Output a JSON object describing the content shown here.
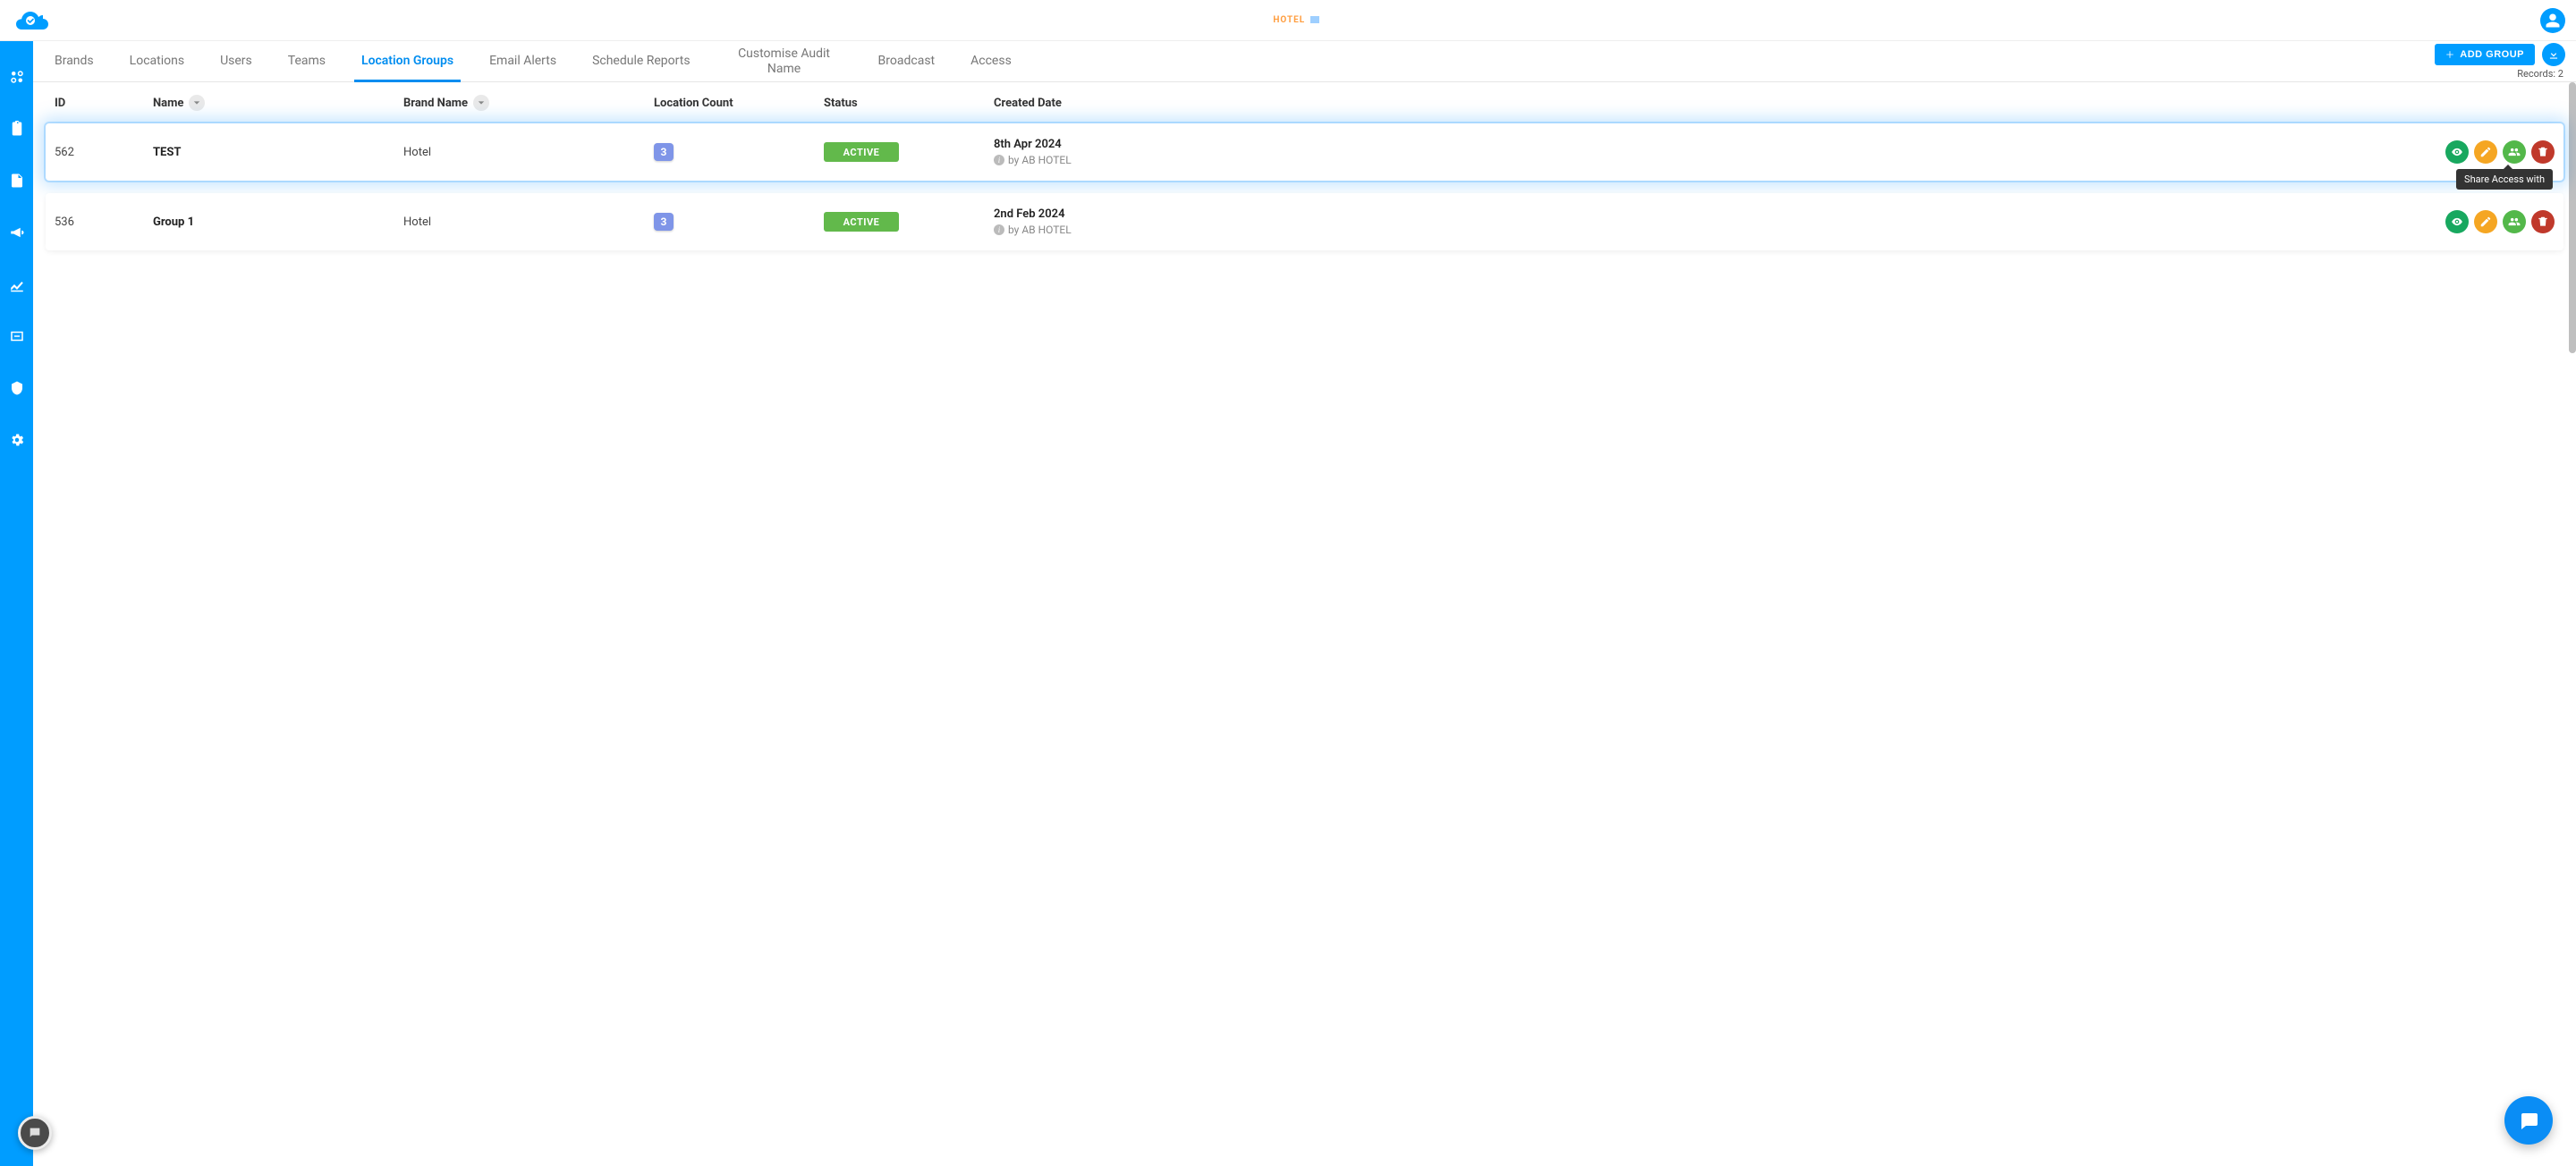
{
  "header": {
    "center_label": "HOTEL"
  },
  "tabs": [
    {
      "label": "Brands",
      "active": false
    },
    {
      "label": "Locations",
      "active": false
    },
    {
      "label": "Users",
      "active": false
    },
    {
      "label": "Teams",
      "active": false
    },
    {
      "label": "Location Groups",
      "active": true
    },
    {
      "label": "Email Alerts",
      "active": false
    },
    {
      "label": "Schedule Reports",
      "active": false
    },
    {
      "label": "Customise Audit Name",
      "active": false
    },
    {
      "label": "Broadcast",
      "active": false
    },
    {
      "label": "Access",
      "active": false
    }
  ],
  "actions": {
    "add_group_label": "ADD GROUP",
    "records_label": "Records: 2"
  },
  "columns": {
    "id": "ID",
    "name": "Name",
    "brand": "Brand Name",
    "location_count": "Location Count",
    "status": "Status",
    "created_date": "Created Date"
  },
  "rows": [
    {
      "id": "562",
      "name": "TEST",
      "brand": "Hotel",
      "location_count": "3",
      "status": "ACTIVE",
      "date": "8th Apr 2024",
      "by": "by AB HOTEL",
      "highlighted": true,
      "show_tooltip": true
    },
    {
      "id": "536",
      "name": "Group 1",
      "brand": "Hotel",
      "location_count": "3",
      "status": "ACTIVE",
      "date": "2nd Feb 2024",
      "by": "by AB HOTEL",
      "highlighted": false,
      "show_tooltip": false
    }
  ],
  "tooltip": {
    "share_access": "Share Access with"
  },
  "sidebar": {
    "items": [
      "dashboard",
      "clipboard",
      "document",
      "announcement",
      "analytics",
      "inbox",
      "security",
      "settings"
    ]
  }
}
